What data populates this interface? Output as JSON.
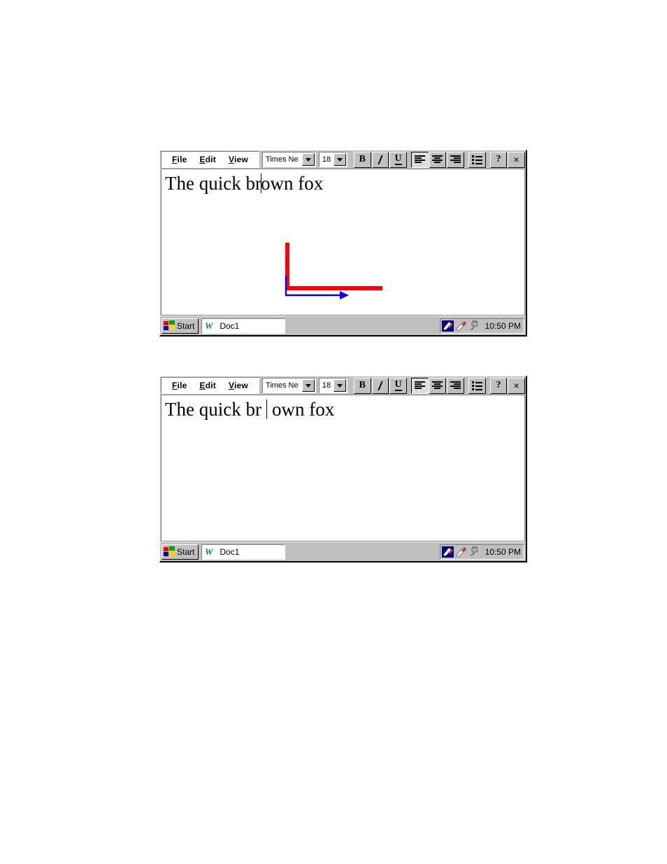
{
  "document_page": {
    "background": "#ffffff",
    "windows": [
      {
        "id": "window-top",
        "menu": [
          {
            "name": "file",
            "accel": "F",
            "rest": "ile"
          },
          {
            "name": "edit",
            "accel": "E",
            "rest": "dit"
          },
          {
            "name": "view",
            "accel": "V",
            "rest": "iew"
          }
        ],
        "font_combo": {
          "value": "Times Ne",
          "placeholder": "Font"
        },
        "size_combo": {
          "value": "18",
          "placeholder": "Size"
        },
        "format_buttons": [
          {
            "name": "bold",
            "label": "B",
            "pressed": false
          },
          {
            "name": "italic",
            "label": "I",
            "pressed": false
          },
          {
            "name": "underline",
            "label": "U",
            "pressed": false
          }
        ],
        "align_buttons": [
          {
            "name": "align-left",
            "label": "Align Left",
            "pressed": true
          },
          {
            "name": "align-center",
            "label": "Align Center",
            "pressed": false
          },
          {
            "name": "align-right",
            "label": "Align Right",
            "pressed": false
          }
        ],
        "list_button": {
          "name": "bullet-list",
          "label": "Bullets"
        },
        "help_button": {
          "name": "help",
          "label": "?"
        },
        "close_button": {
          "name": "close",
          "label": "×"
        },
        "document": {
          "text_before_caret": "The quick br",
          "text_after_caret": "own fox",
          "caret_style": "inline",
          "font": "Times New Roman",
          "size": "18"
        },
        "annotations": {
          "red_path_color": "#ff0000",
          "blue_arrow_color": "#0000ff",
          "description": "red elbow path and blue elbow arrow"
        },
        "taskbar": {
          "start_label": "Start",
          "task_label": "Doc1",
          "time": "10:50 PM",
          "tray_icons": [
            "network-icon",
            "modem-icon",
            "plug-icon"
          ]
        }
      },
      {
        "id": "window-bottom",
        "menu": [
          {
            "name": "file",
            "accel": "F",
            "rest": "ile"
          },
          {
            "name": "edit",
            "accel": "E",
            "rest": "dit"
          },
          {
            "name": "view",
            "accel": "V",
            "rest": "iew"
          }
        ],
        "font_combo": {
          "value": "Times Ne",
          "placeholder": "Font"
        },
        "size_combo": {
          "value": "18",
          "placeholder": "Size"
        },
        "format_buttons": [
          {
            "name": "bold",
            "label": "B",
            "pressed": false
          },
          {
            "name": "italic",
            "label": "I",
            "pressed": false
          },
          {
            "name": "underline",
            "label": "U",
            "pressed": false
          }
        ],
        "align_buttons": [
          {
            "name": "align-left",
            "label": "Align Left",
            "pressed": true
          },
          {
            "name": "align-center",
            "label": "Align Center",
            "pressed": false
          },
          {
            "name": "align-right",
            "label": "Align Right",
            "pressed": false
          }
        ],
        "list_button": {
          "name": "bullet-list",
          "label": "Bullets"
        },
        "help_button": {
          "name": "help",
          "label": "?"
        },
        "close_button": {
          "name": "close",
          "label": "×"
        },
        "document": {
          "text_before_caret": "The quick br",
          "text_after_caret": "own fox",
          "caret_style": "gap",
          "font": "Times New Roman",
          "size": "18"
        },
        "annotations": null,
        "taskbar": {
          "start_label": "Start",
          "task_label": "Doc1",
          "time": "10:50 PM",
          "tray_icons": [
            "network-icon",
            "modem-icon",
            "plug-icon"
          ]
        }
      }
    ]
  }
}
